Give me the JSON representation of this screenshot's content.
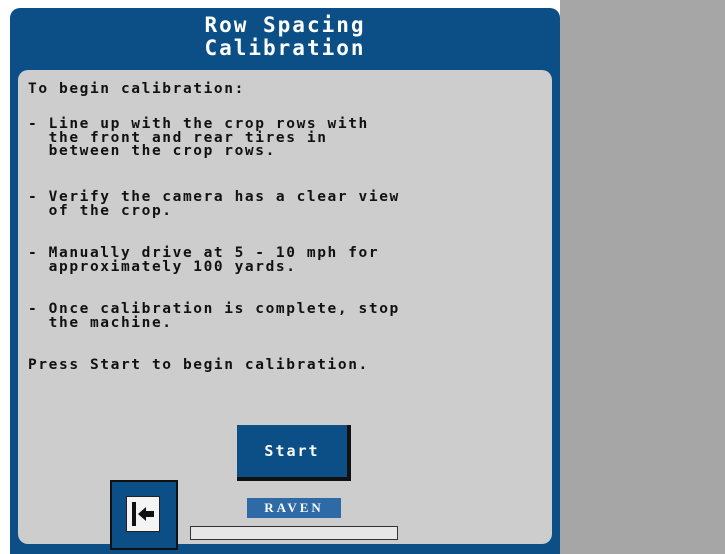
{
  "window": {
    "title_line1": "Row Spacing",
    "title_line2": "Calibration"
  },
  "instructions": {
    "intro": "To begin calibration:",
    "bullets": [
      "- Line up with the crop rows with\n  the front and rear tires in\n  between the crop rows.",
      "- Verify the camera has a clear view\n  of the crop.",
      "- Manually drive at 5 - 10 mph for\n  approximately 100 yards.",
      "- Once calibration is complete, stop\n  the machine."
    ],
    "closing": "Press Start to begin calibration."
  },
  "buttons": {
    "start_label": "Start"
  },
  "brand": {
    "logo_text": "RAVEN"
  },
  "icons": {
    "back": "exit-arrow-icon"
  },
  "progress": {
    "value": 0
  },
  "colors": {
    "frame": "#0b4f86",
    "content": "#cdcdcd",
    "side_panel": "#a6a6a6",
    "logo": "#2d6aa6"
  }
}
